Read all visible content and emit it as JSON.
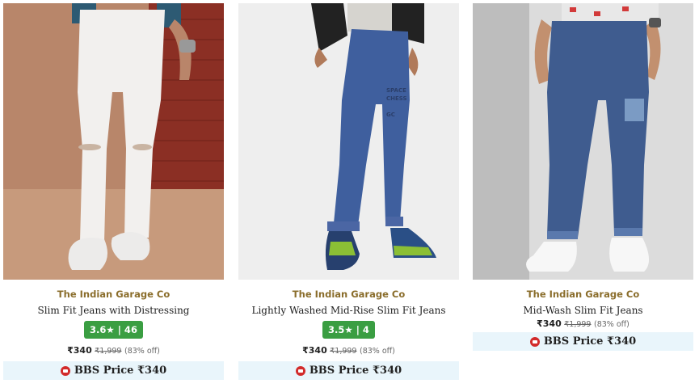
{
  "products": [
    {
      "brand": "The Indian Garage Co",
      "title": "Slim Fit Jeans with Distressing",
      "rating": "3.6★ | 46",
      "price": "₹340",
      "mrp": "₹1,999",
      "discount": "(83% off)",
      "bbs_label": "BBS Price ₹340",
      "image_icon": "white-distressed-jeans-image"
    },
    {
      "brand": "The Indian Garage Co",
      "title": "Lightly Washed Mid-Rise Slim Fit Jeans",
      "rating": "3.5★ | 4",
      "price": "₹340",
      "mrp": "₹1,999",
      "discount": "(83% off)",
      "bbs_label": "BBS Price ₹340",
      "image_icon": "blue-washed-jeans-image"
    },
    {
      "brand": "The Indian Garage Co",
      "title": "Mid-Wash Slim Fit Jeans",
      "price": "₹340",
      "mrp": "₹1,999",
      "discount": "(83% off)",
      "bbs_label": "BBS Price ₹340",
      "image_icon": "mid-wash-jeans-image"
    }
  ],
  "colors": {
    "brand": "#8a6d2b",
    "rating_bg": "#3a9e42",
    "bbs_bg": "#e9f5fb",
    "bbs_logo": "#d22b2b"
  }
}
